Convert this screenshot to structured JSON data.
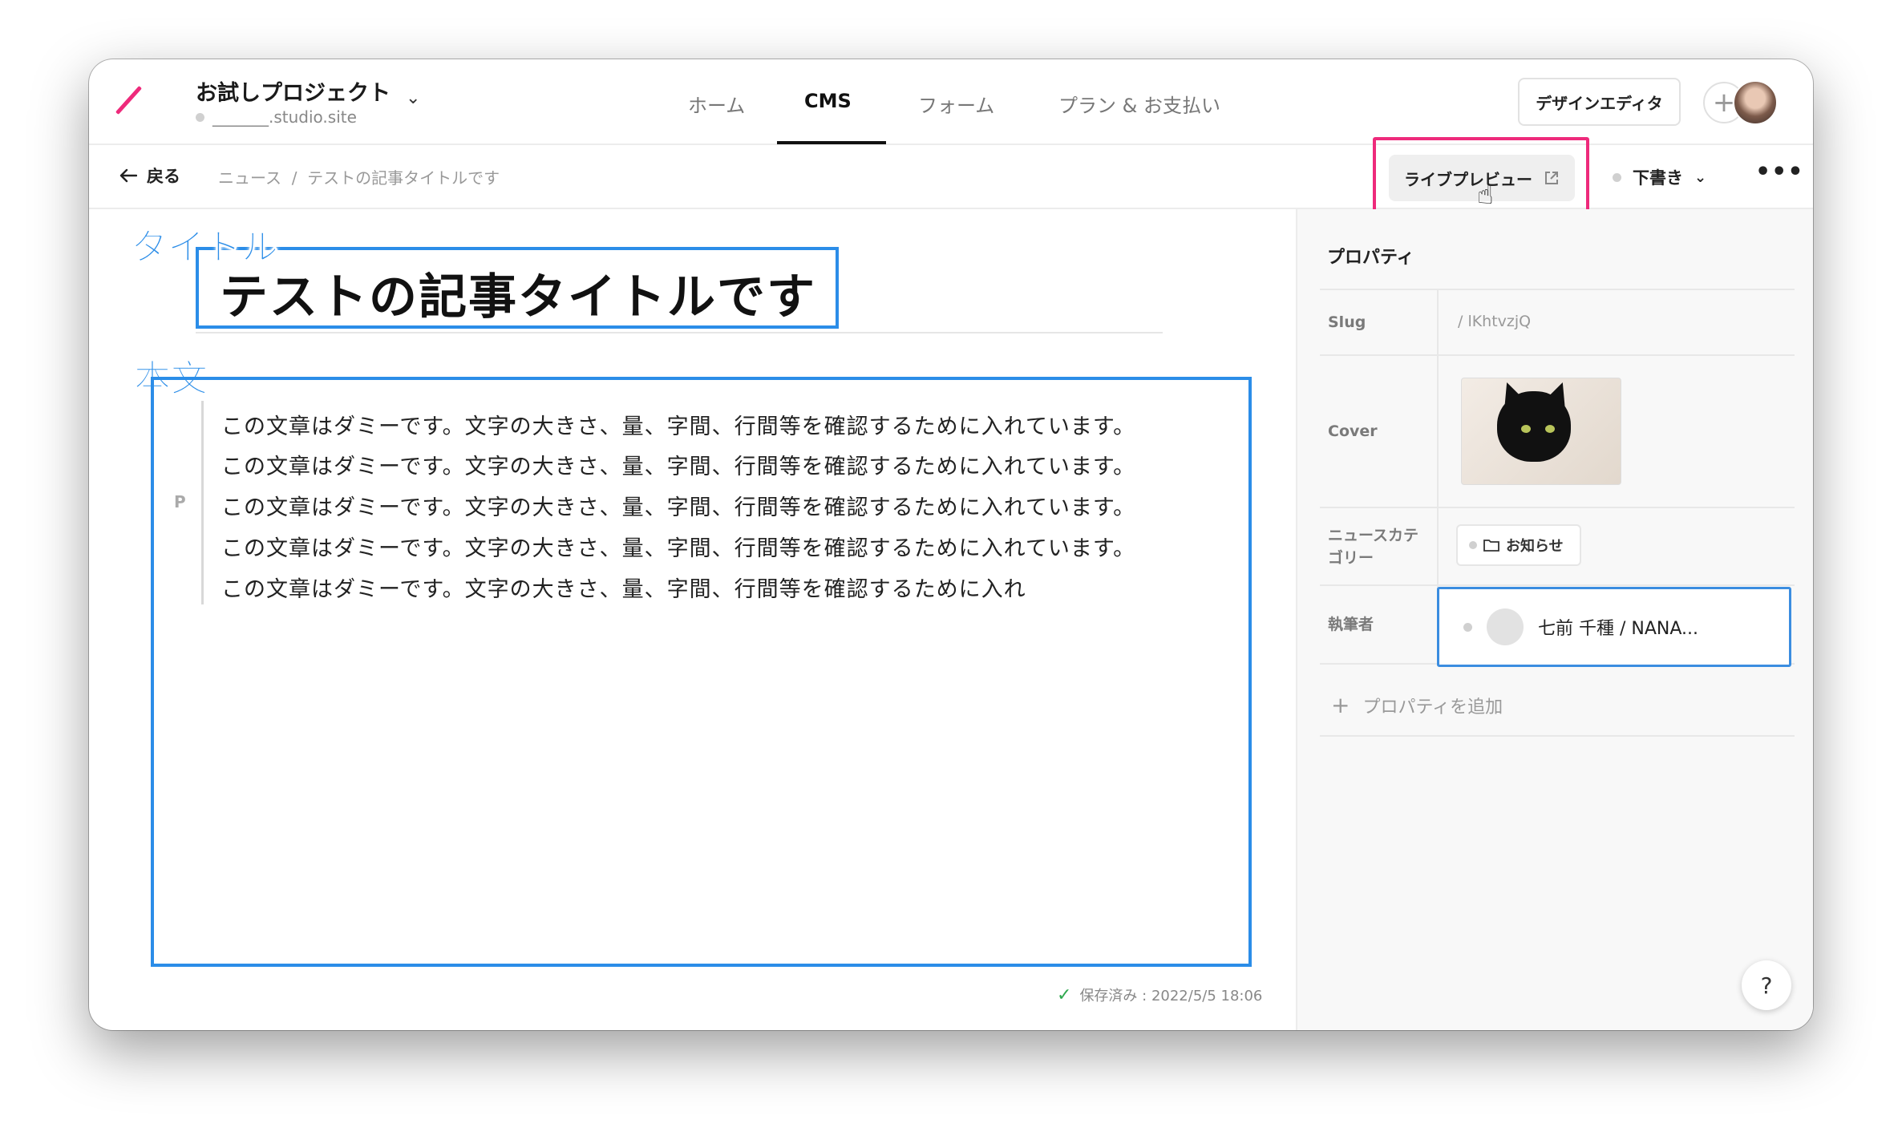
{
  "project": {
    "name": "お試しプロジェクト",
    "domain": "_______.studio.site"
  },
  "nav": {
    "tabs": [
      {
        "label": "ホーム"
      },
      {
        "label": "CMS"
      },
      {
        "label": "フォーム"
      },
      {
        "label": "プラン & お支払い"
      }
    ]
  },
  "header": {
    "design_editor_label": "デザインエディタ"
  },
  "toolbar": {
    "back_label": "戻る",
    "breadcrumb": "ニュース  /  テストの記事タイトルです",
    "live_preview_label": "ライブプレビュー",
    "status_label": "下書き"
  },
  "editor": {
    "title": "テストの記事タイトルです",
    "paragraph_marker": "P",
    "body_lines": [
      "この文章はダミーです。文字の大きさ、量、字間、行間等を確認するために入れています。",
      "この文章はダミーです。文字の大きさ、量、字間、行間等を確認するために入れています。",
      "この文章はダミーです。文字の大きさ、量、字間、行間等を確認するために入れています。",
      "この文章はダミーです。文字の大きさ、量、字間、行間等を確認するために入れています。",
      "この文章はダミーです。文字の大きさ、量、字間、行間等を確認するために入れ"
    ],
    "saved_text": "保存済み : 2022/5/5 18:06"
  },
  "annotations": {
    "title_label": "タイトル",
    "body_label": "本文"
  },
  "properties": {
    "title": "プロパティ",
    "slug_label": "Slug",
    "slug_value": "/ lKhtvzjQ",
    "cover_label": "Cover",
    "category_label": "ニュースカテゴリー",
    "category_value": "お知らせ",
    "author_label": "執筆者",
    "author_value": "七前 千種 / NANA...",
    "add_label": "プロパティを追加"
  },
  "help_label": "?",
  "colors": {
    "accent_pink": "#ee2a7b",
    "annotation_blue": "#2b8de8",
    "saved_green": "#2fa84f"
  },
  "icons": [
    "logo-slash-icon",
    "chevron-down-icon",
    "plus-icon",
    "avatar",
    "back-arrow-icon",
    "external-link-icon",
    "pointer-cursor-icon",
    "more-dots-icon",
    "folder-icon",
    "check-icon",
    "plus-icon"
  ]
}
